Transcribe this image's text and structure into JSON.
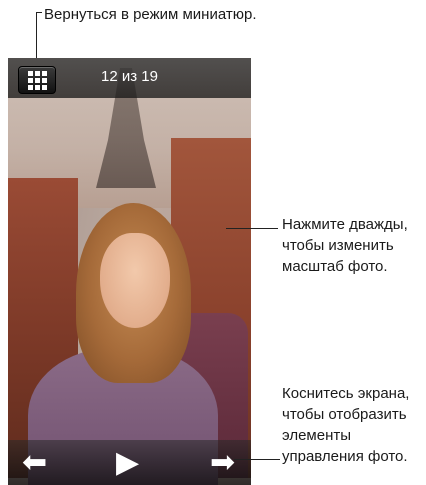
{
  "annotations": {
    "thumbnails": "Вернуться в режим миниатюр.",
    "zoom": [
      "Нажмите дважды,",
      "чтобы изменить",
      "масштаб фото."
    ],
    "controls": [
      "Коснитесь экрана,",
      "чтобы отобразить",
      "элементы",
      "управления фото."
    ]
  },
  "screen": {
    "counter": "12 из 19",
    "controls": {
      "prev_icon": "left-arrow-icon",
      "play_icon": "play-icon",
      "next_icon": "right-arrow-icon",
      "thumbnails_icon": "grid-icon"
    }
  }
}
